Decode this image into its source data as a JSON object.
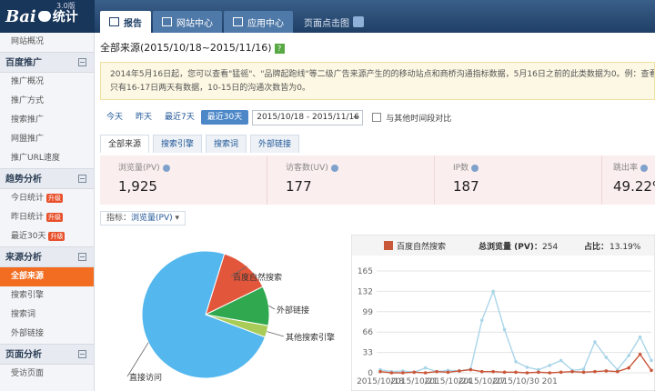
{
  "app": {
    "logo_bai": "Bai",
    "logo_tj": "统计",
    "version": "3.0版"
  },
  "nav_tabs": [
    {
      "label": "报告"
    },
    {
      "label": "网站中心"
    },
    {
      "label": "应用中心"
    },
    {
      "label": "页面点击图"
    }
  ],
  "sidebar": {
    "items": [
      {
        "label": "网站概况",
        "type": "item"
      },
      {
        "label": "百度推广",
        "type": "head"
      },
      {
        "label": "推广概况",
        "type": "item"
      },
      {
        "label": "推广方式",
        "type": "item"
      },
      {
        "label": "搜索推广",
        "type": "item"
      },
      {
        "label": "网盟推广",
        "type": "item"
      },
      {
        "label": "推广URL速度",
        "type": "item"
      },
      {
        "label": "趋势分析",
        "type": "head"
      },
      {
        "label": "今日统计",
        "type": "item",
        "badge": "升级"
      },
      {
        "label": "昨日统计",
        "type": "item",
        "badge": "升级"
      },
      {
        "label": "最近30天",
        "type": "item",
        "badge": "升级"
      },
      {
        "label": "来源分析",
        "type": "head"
      },
      {
        "label": "全部来源",
        "type": "item",
        "active": true
      },
      {
        "label": "搜索引擎",
        "type": "item"
      },
      {
        "label": "搜索词",
        "type": "item"
      },
      {
        "label": "外部链接",
        "type": "item"
      },
      {
        "label": "页面分析",
        "type": "head"
      },
      {
        "label": "受访页面",
        "type": "item"
      }
    ]
  },
  "main": {
    "title": "全部来源(2015/10/18~2015/11/16)",
    "help": "?",
    "notice_line1": "2014年5月16日起，您可以查看\"猛徭\"、\"品牌起跑线\"等二级广告来源产生的的移动站点和商桥沟通指标数据，5月16日之前的此类数据为0。例：查看",
    "notice_line2": "只有16-17日两天有数据，10-15日的沟通次数皆为0。",
    "date_buttons": [
      "今天",
      "昨天",
      "最近7天",
      "最近30天"
    ],
    "date_range": "2015/10/18 - 2015/11/16",
    "compare_label": "与其他时间段对比",
    "sub_tabs": [
      "全部来源",
      "搜索引擎",
      "搜索词",
      "外部链接"
    ],
    "stats": [
      {
        "label": "浏览量(PV)",
        "value": "1,925"
      },
      {
        "label": "访客数(UV)",
        "value": "177"
      },
      {
        "label": "IP数",
        "value": "187"
      },
      {
        "label": "跳出率",
        "value": "49.22%"
      }
    ],
    "indicator_label": "指标：",
    "indicator_value": "浏览量(PV)"
  },
  "colors": {
    "accent": "#f26d21",
    "brand": "#1f3f66",
    "pie_direct": "#54b7ee",
    "pie_baidu": "#e2573b",
    "pie_external": "#2fa84f",
    "pie_other": "#a9cc58"
  },
  "pie": {
    "slices": [
      {
        "label": "百度自然搜索",
        "share": 0.13,
        "color": "#e2573b"
      },
      {
        "label": "外部链接",
        "share": 0.1,
        "color": "#2fa84f"
      },
      {
        "label": "其他搜索引擎",
        "share": 0.03,
        "color": "#a9cc58"
      },
      {
        "label": "直接访问",
        "share": 0.74,
        "color": "#54b7ee"
      }
    ]
  },
  "chart_data": {
    "type": "line",
    "legend_label": "百度自然搜索",
    "summary_label": "总浏览量 (PV)：",
    "summary_value": "254",
    "share_label": "占比：",
    "share_value": "13.19%",
    "y_ticks": [
      0,
      33,
      66,
      99,
      132,
      165
    ],
    "ylim": [
      0,
      165
    ],
    "x_ticks": [
      "2015/10/18",
      "2015/10/21",
      "2015/10/24",
      "2015/10/27",
      "2015/10/30",
      "201"
    ],
    "series": [
      {
        "name": "百度自然搜索",
        "color": "#c9573a",
        "values": [
          2,
          0,
          0,
          1,
          0,
          2,
          1,
          3,
          5,
          2,
          2,
          1,
          1,
          0,
          1,
          0,
          1,
          2,
          1,
          2,
          3,
          2,
          8,
          30,
          4
        ]
      },
      {
        "color": "#a9d5e8",
        "values": [
          5,
          2,
          3,
          1,
          8,
          2,
          4,
          3,
          6,
          85,
          132,
          70,
          18,
          9,
          5,
          12,
          20,
          4,
          6,
          50,
          25,
          5,
          28,
          58,
          20
        ]
      }
    ]
  }
}
